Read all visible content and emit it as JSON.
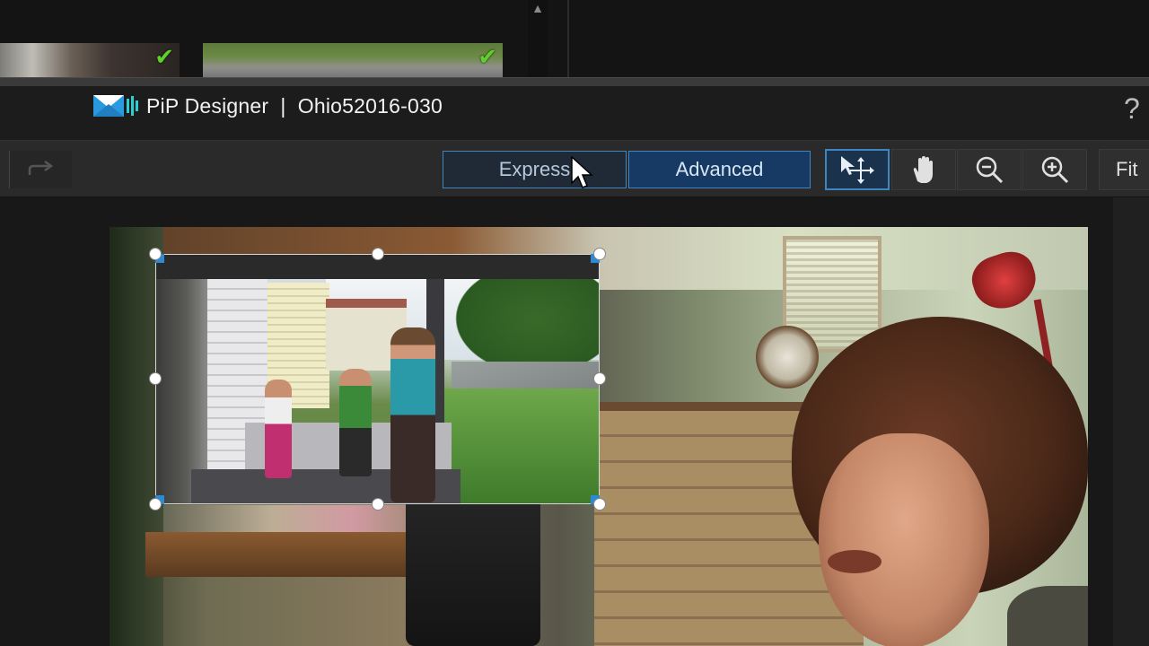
{
  "app": {
    "name": "PiP Designer",
    "separator": "|",
    "project": "Ohio52016-030",
    "title_full": "PiP Designer  |  Ohio52016-030"
  },
  "help": {
    "label": "?"
  },
  "modes": {
    "express": "Express",
    "advanced": "Advanced",
    "active": "Advanced"
  },
  "tools": {
    "fit": "Fit",
    "items": [
      "select-move",
      "hand-pan",
      "zoom-out",
      "zoom-in"
    ]
  },
  "colors": {
    "accent": "#3e86c2",
    "check": "#5fd02b",
    "handle": "#ffffff"
  },
  "icons": {
    "check": "✔",
    "scroll_up": "▲",
    "redo": "redo-arrow"
  }
}
